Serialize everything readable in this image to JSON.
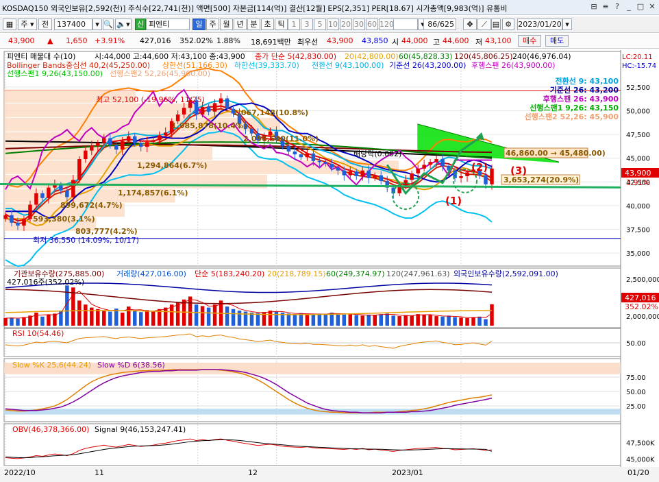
{
  "window": {
    "title": "KOSDAQ150 외국인보유[2,592(천)] 주식수[22,741(천)] 액면[500] 자본금[114(억)] 결산[12월] EPS[2,351] PER[18.67] 시가총액[9,983(억)] 유통비",
    "controls": {
      "link": "⊟",
      "menu": "≡",
      "help": "?",
      "minimize": "_",
      "maximize": "□",
      "close": "✕"
    }
  },
  "toolbar": {
    "period_dropdown": "주",
    "prev_button": "전",
    "code": "137400",
    "search_icon": "search-icon",
    "sound_icon": "speaker-icon",
    "badge": "신",
    "stock_name": "피엔티",
    "intervals": [
      "일",
      "주",
      "월",
      "년",
      "분",
      "초",
      "틱"
    ],
    "selected_interval": "일",
    "minute_options": [
      "1",
      "3",
      "5",
      "10",
      "20",
      "30",
      "60",
      "120"
    ],
    "count": "86",
    "total": "/625",
    "date": "2023/01/20"
  },
  "quote": {
    "price": "43,900",
    "arrow": "▲",
    "change": "1,650",
    "change_pct": "+3.91%",
    "volume": "427,016",
    "vol_ratio": "352.02%",
    "turnover": "1.88%",
    "amount": "18,691백만",
    "best_ask_label": "최우선",
    "best_ask": "43,900",
    "best_bid": "43,850",
    "open_label": "시",
    "open": "44,000",
    "high_label": "고",
    "high": "44,600",
    "low_label": "저",
    "low": "43,100",
    "buy_button": "매수",
    "sell_button": "매도"
  },
  "colors": {
    "up": "#e00000",
    "down": "#1f5fd8",
    "cloud": "#00e000",
    "ma5": "#e00000",
    "ma20": "#e6a000",
    "ma60": "#008000",
    "ma120": "#7a0000",
    "ma240": "#000000",
    "conversion": "#00b0e0",
    "base": "#0000c0",
    "lagging": "#c000c0",
    "bb_center": "#d02000",
    "bb_upper": "#ff7f00",
    "bb_lower": "#00c0f0",
    "trend_line": "#20b060",
    "annotation": "#e00000"
  },
  "main_chart": {
    "legend_line1": [
      "피엔티 매물대 수(10)",
      "시:44,000 고:44,600 저:43,100 종:43,900",
      "종가 단순 5(42,830.00)",
      "20(42,800.00)",
      "60(45,828.33)",
      "120(45,806.25)",
      "240(46,976.04)"
    ],
    "legend_line2": [
      "Bollinger Bands중심선 40,2(45,250.00)",
      "상한선(51,166.30)",
      "하한선(39,333.70)",
      "전환선 9(43,100.00)",
      "기준선 26(43,200.00)",
      "후행스팬 26(43,900.00)"
    ],
    "legend_line3": [
      "선행스팬1 9,26(43,150.00)",
      "선행스팬2 52,26(45,900.00)"
    ],
    "right_labels": {
      "lc": "LC:20.11",
      "hc": "HC:-15.74",
      "price_tag": "43,900",
      "pct_tag": "3.91%"
    },
    "ichimoku_box": [
      "전환선 9: 43,100",
      "기준선 26: 43,200",
      "후행스팬 26: 43,900",
      "선행스팬1 9,26: 43,150",
      "선행스팬2 52,26: 45,900"
    ],
    "annotations": {
      "high": "최고 52,100 (-19.96%, 11/25)",
      "low": "최저 36,550 (14.09%, 10/17)",
      "vp1": "2,067,148(10.8%)",
      "vp2": "1,985,878(10.4%)",
      "vp3": "2,096,500(11.0%)",
      "vp4": "1,294,864(6.7%)",
      "vp5": "1,174,857(6.1%)",
      "vp6": "899,672(4.7%)",
      "vp7": "593,380(3.1%)",
      "vp8": "803,777(4.2%)",
      "vp9": "3,653,274(20.9%)",
      "dividend": "배당락(0.002)",
      "ma_tag": "46,860.00 → 45,480.00)",
      "mark1": "(1)",
      "mark2": "(2)",
      "mark3": "(3)"
    }
  },
  "volume_panel": {
    "legend": [
      "기관보유수량(275,885.00)",
      "거래량(427,016.00)",
      "단순 5(183,240.20)",
      "20(218,789.15)",
      "60(249,374.97)",
      "120(247,961.63)",
      "외국인보유수량(2,592,091.00)"
    ],
    "left_label": "427,016주(352.02%)",
    "right_tags": [
      "427,016",
      "352.02%"
    ]
  },
  "rsi_panel": {
    "legend": [
      "RSI 10(54.46)"
    ]
  },
  "stoch_panel": {
    "legend": [
      "Slow %K 25,6(44.24)",
      "Slow %D 6(38.56)"
    ]
  },
  "obv_panel": {
    "legend": [
      "OBV(46,378,366.00)",
      "Signal 9(46,153,247.41)"
    ]
  },
  "x_axis": {
    "labels": [
      "2022/10",
      "11",
      "12",
      "2023/01"
    ],
    "right": "01/20"
  },
  "chart_data": [
    {
      "type": "candlestick",
      "title": "피엔티 일봉",
      "y_axis": {
        "ticks": [
          "52,500",
          "50,000",
          "47,500",
          "45,000",
          "42,500",
          "40,000",
          "37,500",
          "35,000"
        ],
        "ylim": [
          34000,
          53500
        ]
      },
      "dates": [
        "2022/10",
        "11",
        "12",
        "2023/01"
      ],
      "close": [
        39000,
        38200,
        37900,
        38600,
        40100,
        41300,
        40800,
        41900,
        42200,
        41600,
        40900,
        42700,
        44900,
        45800,
        46300,
        46600,
        47100,
        46400,
        45900,
        46800,
        47300,
        46600,
        46200,
        46700,
        46900,
        47400,
        47700,
        48900,
        49600,
        50300,
        51100,
        49600,
        50400,
        49900,
        50800,
        51300,
        50200,
        49700,
        48600,
        48100,
        47600,
        46900,
        47400,
        47800,
        46900,
        46300,
        45700,
        45400,
        45100,
        45500,
        44700,
        44600,
        44400,
        44000,
        43700,
        43200,
        43600,
        43100,
        43700,
        42900,
        43200,
        42600,
        41900,
        41300,
        42100,
        42700,
        43400,
        43900,
        44300,
        44600,
        44900,
        44200,
        43700,
        42900,
        43100,
        43500,
        43800,
        43200,
        42250,
        43900
      ],
      "ma5": [
        39100,
        38700,
        38400,
        38500,
        39000,
        39800,
        40400,
        41000,
        41500,
        41700,
        41900,
        42200,
        42900,
        43800,
        44800,
        45700,
        46400,
        46700,
        46800,
        46900,
        47000,
        46900,
        46800,
        46800,
        46800,
        47000,
        47300,
        47700,
        48300,
        48900,
        49600,
        49900,
        50200,
        50400,
        50400,
        50500,
        50300,
        50100,
        49700,
        48900,
        48300,
        47600,
        47400,
        47300,
        47300,
        47000,
        46600,
        46300,
        45900,
        45500,
        45300,
        45100,
        44900,
        44600,
        44300,
        43900,
        43700,
        43500,
        43400,
        43300,
        43200,
        43000,
        42800,
        42500,
        42300,
        42200,
        42300,
        42700,
        43200,
        43800,
        44300,
        44500,
        44400,
        44100,
        43800,
        43600,
        43600,
        43500,
        43300,
        42830
      ]
    },
    {
      "type": "bar",
      "title": "거래량",
      "y_axis": {
        "ticks": [
          "2,500,000",
          "2,000,000"
        ]
      },
      "values": [
        150000,
        160000,
        140000,
        170000,
        200000,
        260000,
        180000,
        220000,
        240000,
        300000,
        800000,
        760000,
        500000,
        420000,
        360000,
        330000,
        300000,
        280000,
        340000,
        260000,
        380000,
        300000,
        270000,
        310000,
        290000,
        330000,
        360000,
        420000,
        460000,
        520000,
        580000,
        420000,
        390000,
        360000,
        420000,
        500000,
        380000,
        330000,
        300000,
        280000,
        260000,
        250000,
        270000,
        300000,
        280000,
        260000,
        240000,
        230000,
        250000,
        230000,
        220000,
        240000,
        230000,
        260000,
        230000,
        220000,
        240000,
        210000,
        200000,
        220000,
        210000,
        230000,
        240000,
        200000,
        190000,
        210000,
        200000,
        230000,
        220000,
        210000,
        190000,
        180000,
        200000,
        170000,
        160000,
        150000,
        170000,
        180000,
        130000,
        427016
      ]
    },
    {
      "type": "line",
      "title": "RSI 10",
      "y_axis": {
        "ticks": [
          "50.00"
        ],
        "ylim": [
          20,
          80
        ]
      },
      "values": [
        45,
        43,
        42,
        44,
        48,
        52,
        50,
        53,
        54,
        52,
        50,
        56,
        61,
        63,
        64,
        65,
        66,
        63,
        61,
        64,
        65,
        63,
        61,
        63,
        64,
        65,
        66,
        68,
        70,
        71,
        73,
        66,
        68,
        66,
        69,
        70,
        66,
        64,
        60,
        58,
        56,
        53,
        55,
        57,
        53,
        51,
        49,
        48,
        47,
        49,
        46,
        46,
        45,
        44,
        43,
        42,
        44,
        42,
        45,
        41,
        43,
        40,
        38,
        36,
        41,
        44,
        47,
        50,
        52,
        53,
        55,
        51,
        49,
        45,
        46,
        48,
        50,
        47,
        44,
        54.46
      ]
    },
    {
      "type": "line",
      "title": "Slow Stochastic",
      "y_axis": {
        "ticks": [
          "75.00",
          "50.00",
          "25.00"
        ],
        "ylim": [
          0,
          100
        ]
      },
      "series": [
        {
          "name": "Slow %K 25,6",
          "values": [
            18,
            17,
            16,
            16,
            17,
            18,
            20,
            22,
            25,
            30,
            36,
            44,
            52,
            60,
            67,
            72,
            76,
            79,
            81,
            83,
            84,
            85,
            86,
            86,
            87,
            87,
            87,
            88,
            88,
            88,
            88,
            88,
            88,
            88,
            88,
            87,
            86,
            84,
            82,
            79,
            75,
            70,
            64,
            57,
            50,
            43,
            36,
            30,
            25,
            21,
            18,
            16,
            15,
            14,
            14,
            13,
            13,
            13,
            13,
            13,
            14,
            14,
            14,
            14,
            15,
            16,
            17,
            18,
            20,
            22,
            25,
            28,
            31,
            33,
            35,
            37,
            39,
            40,
            42,
            44.24
          ]
        },
        {
          "name": "Slow %D 6",
          "values": [
            20,
            19,
            18,
            17,
            17,
            17,
            18,
            19,
            21,
            23,
            27,
            32,
            38,
            45,
            52,
            59,
            65,
            70,
            74,
            77,
            79,
            81,
            83,
            84,
            85,
            85,
            86,
            86,
            87,
            87,
            87,
            87,
            88,
            88,
            88,
            88,
            87,
            86,
            85,
            83,
            80,
            77,
            73,
            68,
            62,
            55,
            48,
            42,
            36,
            30,
            26,
            22,
            19,
            17,
            16,
            15,
            14,
            14,
            13,
            13,
            13,
            13,
            14,
            14,
            14,
            14,
            15,
            15,
            16,
            17,
            19,
            21,
            23,
            26,
            28,
            30,
            32,
            34,
            36,
            38.56
          ]
        }
      ]
    },
    {
      "type": "line",
      "title": "OBV",
      "y_axis": {
        "ticks": [
          "47,500K",
          "45,000K"
        ],
        "ylim": [
          44200,
          48800
        ]
      },
      "series": [
        {
          "name": "OBV",
          "values": [
            45200,
            45100,
            45050,
            45150,
            45300,
            45500,
            45400,
            45600,
            45750,
            45650,
            45500,
            45800,
            46300,
            46600,
            46800,
            46950,
            47100,
            46900,
            46800,
            47000,
            47200,
            47050,
            46900,
            47000,
            47100,
            47300,
            47400,
            47600,
            47800,
            47900,
            48050,
            47800,
            47950,
            47800,
            47950,
            48050,
            47850,
            47700,
            47500,
            47350,
            47200,
            47050,
            47150,
            47250,
            47100,
            46950,
            46850,
            46800,
            46750,
            46850,
            46700,
            46650,
            46600,
            46550,
            46500,
            46450,
            46550,
            46450,
            46600,
            46400,
            46500,
            46350,
            46250,
            46150,
            46300,
            46400,
            46500,
            46600,
            46650,
            46700,
            46750,
            46600,
            46550,
            46400,
            46450,
            46500,
            46550,
            46450,
            46300,
            46378
          ]
        },
        {
          "name": "Signal 9",
          "values": [
            45300,
            45250,
            45200,
            45180,
            45200,
            45280,
            45330,
            45400,
            45480,
            45530,
            45570,
            45640,
            45780,
            45950,
            46120,
            46280,
            46450,
            46580,
            46680,
            46780,
            46880,
            46950,
            46980,
            47000,
            47030,
            47080,
            47150,
            47250,
            47380,
            47500,
            47630,
            47700,
            47780,
            47820,
            47880,
            47930,
            47920,
            47890,
            47820,
            47720,
            47600,
            47480,
            47380,
            47300,
            47230,
            47150,
            47060,
            46980,
            46920,
            46880,
            46830,
            46780,
            46730,
            46680,
            46640,
            46600,
            46570,
            46540,
            46530,
            46500,
            46490,
            46470,
            46440,
            46400,
            46370,
            46360,
            46370,
            46400,
            46430,
            46470,
            46520,
            46550,
            46560,
            46540,
            46520,
            46510,
            46500,
            46490,
            46460,
            46153
          ]
        }
      ]
    }
  ]
}
